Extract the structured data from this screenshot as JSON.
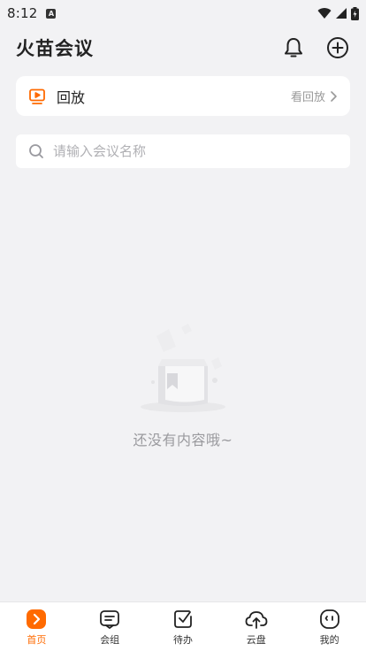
{
  "status_bar": {
    "time": "8:12",
    "notification_badge": "A"
  },
  "header": {
    "title": "火苗会议"
  },
  "replay": {
    "label": "回放",
    "link": "看回放"
  },
  "search": {
    "placeholder": "请输入会议名称",
    "value": ""
  },
  "empty_state": {
    "message": "还没有内容哦~"
  },
  "nav": {
    "items": [
      {
        "label": "首页",
        "icon": "home-icon",
        "active": true
      },
      {
        "label": "会组",
        "icon": "group-icon",
        "active": false
      },
      {
        "label": "待办",
        "icon": "todo-icon",
        "active": false
      },
      {
        "label": "云盘",
        "icon": "cloud-upload-icon",
        "active": false
      },
      {
        "label": "我的",
        "icon": "profile-icon",
        "active": false
      }
    ]
  },
  "colors": {
    "accent": "#ff6a00",
    "background": "#f2f2f4",
    "card": "#ffffff"
  }
}
